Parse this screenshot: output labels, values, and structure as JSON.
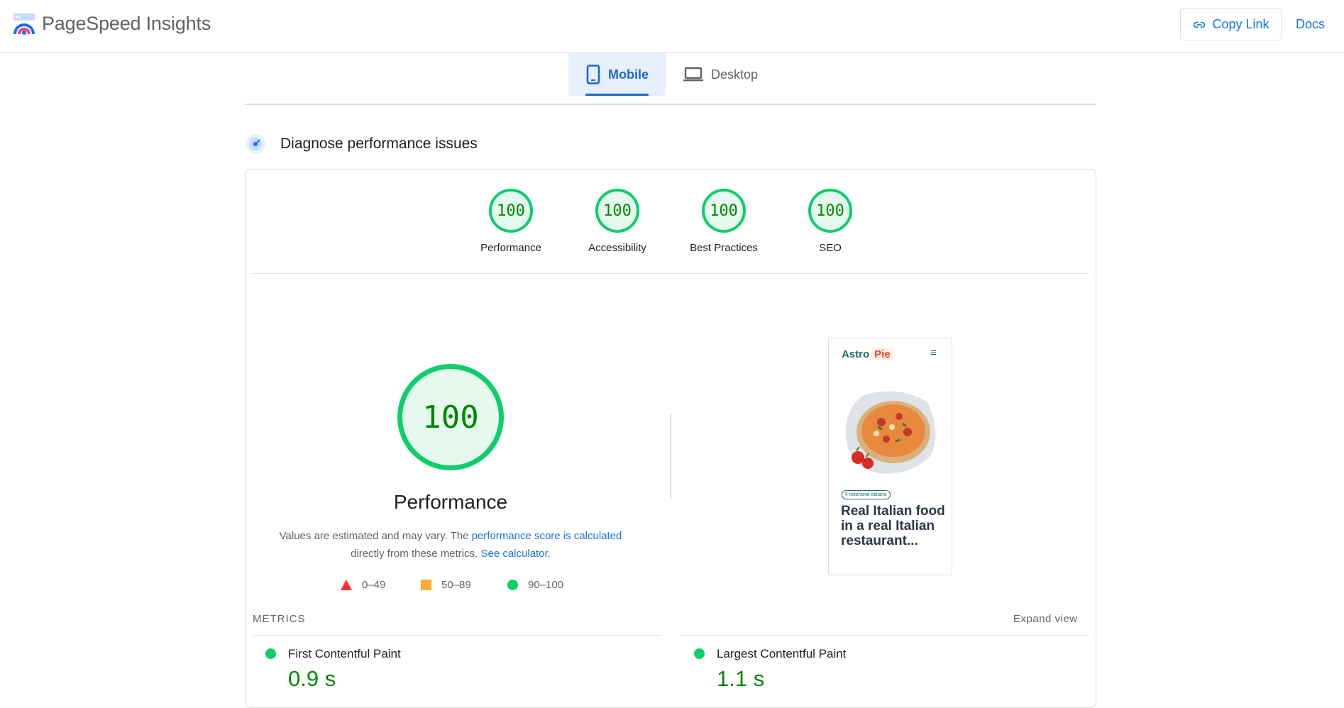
{
  "app": {
    "title": "PageSpeed Insights"
  },
  "header": {
    "copy_link": "Copy Link",
    "docs": "Docs"
  },
  "tabs": [
    {
      "label": "Mobile",
      "active": true
    },
    {
      "label": "Desktop",
      "active": false
    }
  ],
  "section": {
    "title": "Diagnose performance issues"
  },
  "categories": [
    {
      "score": "100",
      "label": "Performance"
    },
    {
      "score": "100",
      "label": "Accessibility"
    },
    {
      "score": "100",
      "label": "Best Practices"
    },
    {
      "score": "100",
      "label": "SEO"
    }
  ],
  "performance": {
    "score": "100",
    "title": "Performance",
    "desc_prefix": "Values are estimated and may vary. The ",
    "desc_link1": "performance score is calculated",
    "desc_middle": " directly from these metrics. ",
    "desc_link2": "See calculator."
  },
  "legend": [
    {
      "range": "0–49",
      "shape": "triangle",
      "color": "#ff3333"
    },
    {
      "range": "50–89",
      "shape": "square",
      "color": "#ffaa33"
    },
    {
      "range": "90–100",
      "shape": "circle",
      "color": "#0cce6b"
    }
  ],
  "preview": {
    "brand_a": "Astro",
    "brand_b": "Pie",
    "menu_icon": "≡",
    "tag": "Il ristorante italiano",
    "headline": "Real Italian food in a real Italian restaurant..."
  },
  "metrics": {
    "label": "METRICS",
    "expand": "Expand view",
    "items": [
      {
        "name": "First Contentful Paint",
        "value": "0.9 s",
        "status": "good"
      },
      {
        "name": "Largest Contentful Paint",
        "value": "1.1 s",
        "status": "good"
      }
    ]
  },
  "colors": {
    "pass": "#0cce6b",
    "pass_text": "#008800",
    "accent": "#1a73e8"
  }
}
